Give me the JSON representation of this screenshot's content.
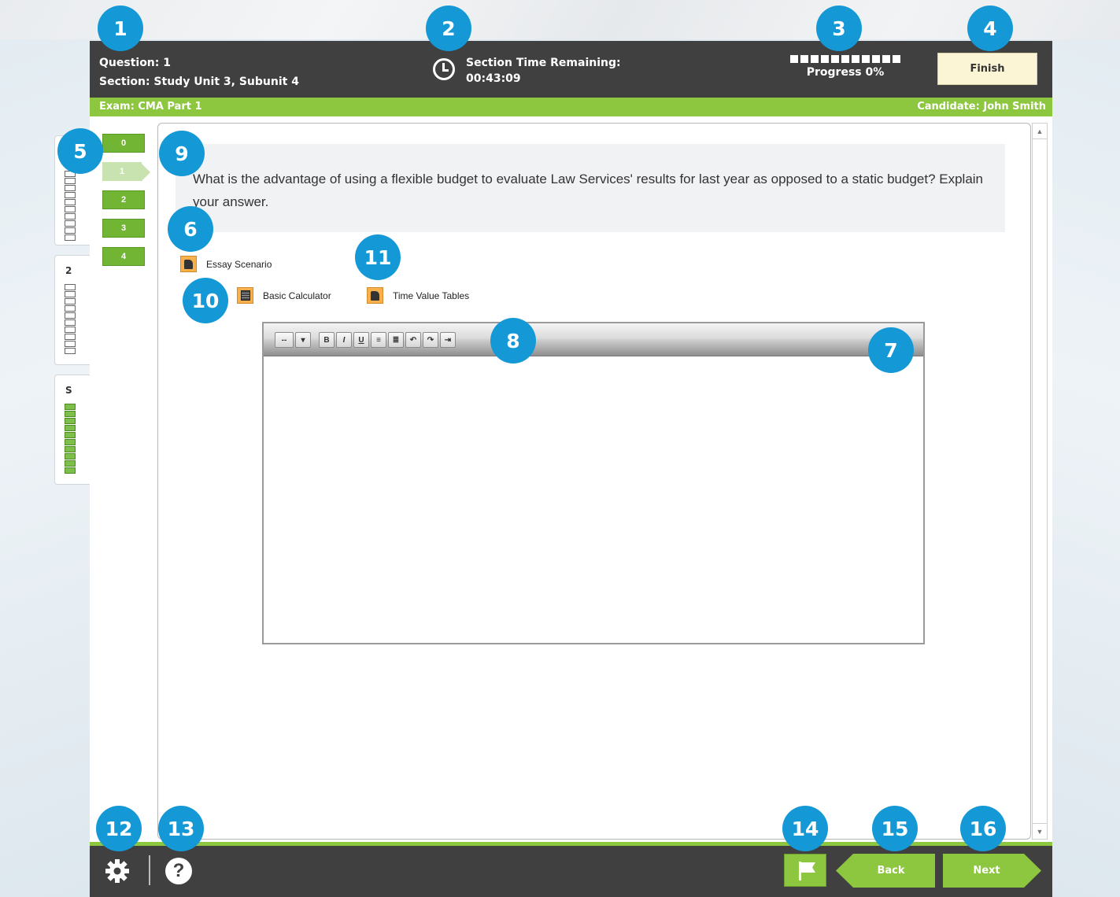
{
  "header": {
    "question_label": "Question: 1",
    "section_label": "Section: Study Unit 3, Subunit 4",
    "timer_title": "Section Time Remaining:",
    "timer_value": "00:43:09",
    "progress_label": "Progress 0%",
    "progress_percent": 0,
    "progress_segments": 11,
    "finish_label": "Finish"
  },
  "exam_bar": {
    "exam_name": "Exam: CMA Part 1",
    "candidate": "Candidate: John Smith"
  },
  "question_nav": {
    "items": [
      "0",
      "1",
      "2",
      "3",
      "4"
    ],
    "current": "1"
  },
  "section_tabs": [
    {
      "label": "",
      "completed": false,
      "segments": 10
    },
    {
      "label": "2",
      "completed": false,
      "segments": 10
    },
    {
      "label": "S",
      "completed": true,
      "segments": 10
    }
  ],
  "question": {
    "text": "What is the advantage of using a flexible budget to evaluate Law Services' results for last year as opposed to a static budget? Explain your answer."
  },
  "resources": {
    "essay_scenario": "Essay Scenario",
    "calculator": "Basic Calculator",
    "time_value_tables": "Time Value Tables"
  },
  "editor": {
    "font_select": "--",
    "buttons": {
      "bold": "B",
      "italic": "I",
      "underline": "U",
      "undo": "↶",
      "redo": "↷"
    },
    "content": ""
  },
  "footer": {
    "back_label": "Back",
    "next_label": "Next"
  },
  "callouts": [
    "1",
    "2",
    "3",
    "4",
    "5",
    "6",
    "7",
    "8",
    "9",
    "10",
    "11",
    "12",
    "13",
    "14",
    "15",
    "16"
  ],
  "colors": {
    "header_bg": "#404040",
    "accent_green": "#8dc63f",
    "callout_blue": "#1499d6",
    "finish_bg": "#fbf5d5",
    "resource_orange": "#f7b04b"
  }
}
